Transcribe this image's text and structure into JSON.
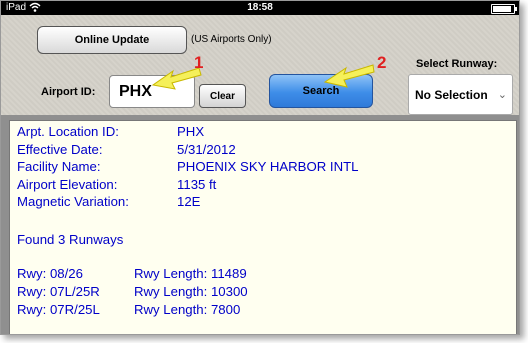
{
  "statusbar": {
    "carrier": "iPad",
    "time": "18:58",
    "battery_level": 0.9
  },
  "toppanel": {
    "online_update_label": "Online Update",
    "note": "(US Airports Only)",
    "airport_id_label": "Airport ID:",
    "airport_id_value": "PHX",
    "clear_label": "Clear",
    "search_label": "Search",
    "select_runway_label": "Select Runway:",
    "select_runway_value": "No Selection"
  },
  "annotations": {
    "marker_1": "1",
    "marker_2": "2",
    "arrow_color": "#f5f05a",
    "marker_color": "#e02020"
  },
  "output": {
    "lines": [
      {
        "key": "Arpt. Location ID:",
        "value": "PHX"
      },
      {
        "key": "Effective Date:",
        "value": "5/31/2012"
      },
      {
        "key": "Facility Name:",
        "value": "PHOENIX SKY HARBOR INTL"
      },
      {
        "key": "Airport Elevation:",
        "value": "1135 ft"
      },
      {
        "key": "Magnetic Variation:",
        "value": "12E"
      }
    ],
    "found": "Found 3 Runways",
    "runways": [
      {
        "rwy": "Rwy: 08/26",
        "length": "Rwy Length: 11489"
      },
      {
        "rwy": "Rwy: 07L/25R",
        "length": "Rwy Length: 10300"
      },
      {
        "rwy": "Rwy: 07R/25L",
        "length": "Rwy Length: 7800"
      }
    ]
  },
  "colors": {
    "text_output": "#0000c8",
    "search_button": "#3e8de8",
    "panel_bg": "#d6d3cb"
  }
}
